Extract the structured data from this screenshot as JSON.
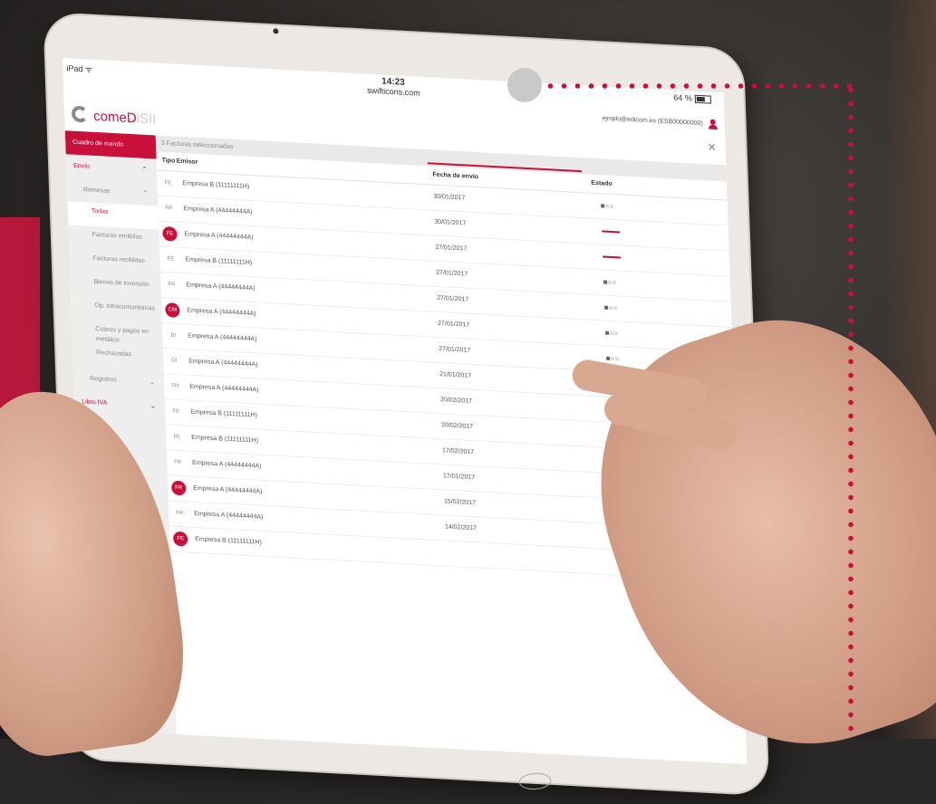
{
  "status_bar": {
    "carrier": "iPad ᯤ",
    "time": "14:23",
    "url": "swifticons.com",
    "battery": "64 %"
  },
  "user": {
    "email": "ejmplo@edicom.es (ESB00000000)"
  },
  "logo": {
    "part_a": "comeD",
    "part_b": "iSII"
  },
  "close_label": "✕",
  "sidebar": {
    "items": [
      {
        "label": "Cuadro de mando"
      },
      {
        "label": "Envío"
      },
      {
        "label": "Remesas"
      },
      {
        "label": "Todas"
      },
      {
        "label": "Facturas emitidas"
      },
      {
        "label": "Facturas recibidas"
      },
      {
        "label": "Bienes de inversión"
      },
      {
        "label": "Op. intracomunitarias"
      },
      {
        "label": "Cobros y pagos en metálico"
      },
      {
        "label": "Rechazadas"
      },
      {
        "label": "Registros"
      },
      {
        "label": "Libro IVA"
      }
    ]
  },
  "selection_text": "3 Facturas seleccionadas",
  "table": {
    "headers": {
      "tipo": "Tipo",
      "emisor": "Emisor",
      "fecha": "Fecha de envío",
      "estado": "Estado"
    },
    "rows": [
      {
        "tipo": "FE",
        "emisor": "Empresa B (11111111H)",
        "fecha": "30/01/2017"
      },
      {
        "tipo": "FR",
        "emisor": "Empresa A (44444444A)",
        "fecha": "30/01/2017"
      },
      {
        "tipo": "FE",
        "emisor": "Empresa A (44444444A)",
        "fecha": "27/01/2017"
      },
      {
        "tipo": "FE",
        "emisor": "Empresa B (11111111H)",
        "fecha": "27/01/2017"
      },
      {
        "tipo": "FR",
        "emisor": "Empresa A (44444444A)",
        "fecha": "27/01/2017"
      },
      {
        "tipo": "CM",
        "emisor": "Empresa A (44444444A)",
        "fecha": "27/01/2017"
      },
      {
        "tipo": "BI",
        "emisor": "Empresa A (44444444A)",
        "fecha": "27/01/2017"
      },
      {
        "tipo": "OI",
        "emisor": "Empresa A (44444444A)",
        "fecha": "21/01/2017"
      },
      {
        "tipo": "FR",
        "emisor": "Empresa A (44444444A)",
        "fecha": "20/02/2017"
      },
      {
        "tipo": "FE",
        "emisor": "Empresa B (11111111H)",
        "fecha": "20/02/2017"
      },
      {
        "tipo": "FE",
        "emisor": "Empresa B (11111111H)",
        "fecha": "17/02/2017"
      },
      {
        "tipo": "FR",
        "emisor": "Empresa A (44444444A)",
        "fecha": "17/01/2017"
      },
      {
        "tipo": "FR",
        "emisor": "Empresa A (44444444A)",
        "fecha": "15/02/2017"
      },
      {
        "tipo": "FR",
        "emisor": "Empresa A (44444444A)",
        "fecha": "14/02/2017"
      },
      {
        "tipo": "FE",
        "emisor": "Empresa B (11111111H)",
        "fecha": ""
      }
    ]
  },
  "colors": {
    "accent": "#c8103a"
  }
}
